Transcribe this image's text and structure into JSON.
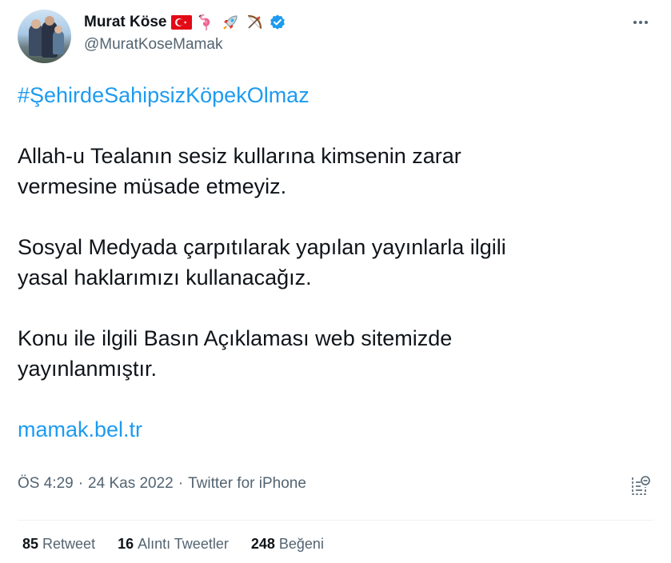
{
  "author": {
    "name": "Murat Köse",
    "handle": "@MuratKoseMamak",
    "verified": true,
    "name_emojis": [
      "turkish-flag",
      "flamingo",
      "rocket",
      "bow-and-arrow"
    ]
  },
  "tweet": {
    "hashtag": "#ŞehirdeSahipsizKöpekOlmaz",
    "paragraphs": [
      [
        "Allah-u Tealanın sesiz kullarına kimsenin zarar",
        "vermesine müsade etmeyiz."
      ],
      [
        "Sosyal Medyada çarpıtılarak yapılan yayınlarla ilgili",
        "yasal haklarımızı kullanacağız."
      ],
      [
        "Konu ile ilgili Basın Açıklaması web sitemizde",
        "yayınlanmıştır."
      ]
    ],
    "link": "mamak.bel.tr"
  },
  "meta": {
    "time": "ÖS 4:29",
    "separator": "·",
    "date": "24 Kas 2022",
    "source": "Twitter for iPhone"
  },
  "stats": {
    "retweets_count": "85",
    "retweets_label": "Retweet",
    "quotes_count": "16",
    "quotes_label": "Alıntı Tweetler",
    "likes_count": "248",
    "likes_label": "Beğeni"
  },
  "colors": {
    "link": "#1d9bf0",
    "text": "#0f1419",
    "secondary": "#536471",
    "verified": "#1d9bf0"
  }
}
